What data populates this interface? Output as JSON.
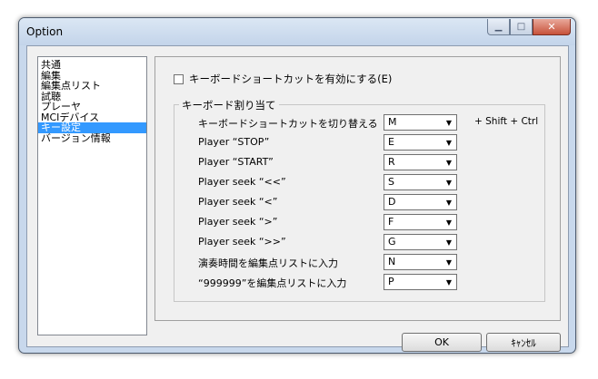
{
  "window": {
    "title": "Option"
  },
  "caption_buttons": {
    "minimize": "minimize-icon",
    "maximize": "maximize-icon",
    "close": "close-icon"
  },
  "sidebar": {
    "items": [
      {
        "label": "共通",
        "selected": false
      },
      {
        "label": "編集",
        "selected": false
      },
      {
        "label": "編集点リスト",
        "selected": false
      },
      {
        "label": "試聴",
        "selected": false
      },
      {
        "label": "プレーヤ",
        "selected": false
      },
      {
        "label": "MCIデバイス",
        "selected": false
      },
      {
        "label": "キー設定",
        "selected": true
      },
      {
        "label": "バージョン情報",
        "selected": false
      }
    ]
  },
  "main": {
    "enable_shortcuts": {
      "label": "キーボードショートカットを有効にする(E)",
      "checked": false
    },
    "key_assign": {
      "title": "キーボード割り当て",
      "modifier_label": "+ Shift + Ctrl",
      "rows": [
        {
          "label": "キーボードショートカットを切り替える",
          "key": "M"
        },
        {
          "label": "Player “STOP”",
          "key": "E"
        },
        {
          "label": "Player “START”",
          "key": "R"
        },
        {
          "label": "Player seek “<<”",
          "key": "S"
        },
        {
          "label": "Player seek “<”",
          "key": "D"
        },
        {
          "label": "Player seek “>”",
          "key": "F"
        },
        {
          "label": "Player seek “>>”",
          "key": "G"
        },
        {
          "label": "演奏時間を編集点リストに入力",
          "key": "N"
        },
        {
          "label": "“999999”を編集点リストに入力",
          "key": "P"
        }
      ]
    }
  },
  "buttons": {
    "ok": "OK",
    "cancel": "ｷｬﾝｾﾙ"
  }
}
